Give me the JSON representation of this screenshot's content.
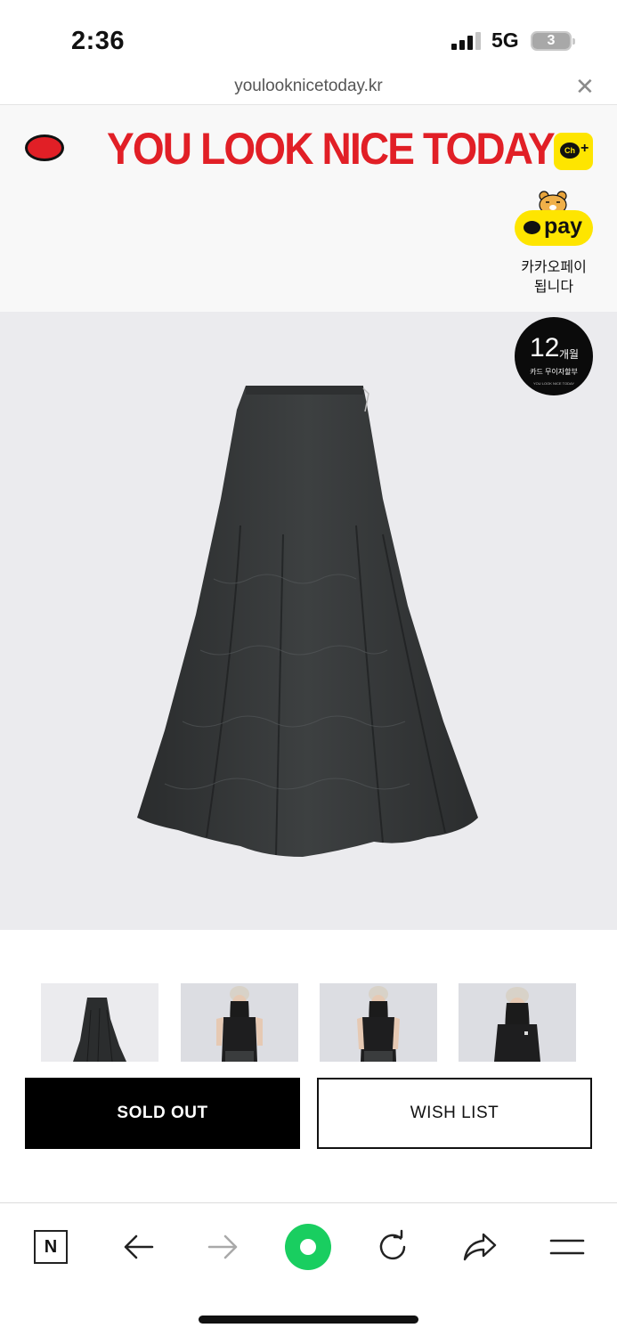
{
  "status_bar": {
    "time": "2:36",
    "network": "5G",
    "battery": "3",
    "colors": {
      "battery_low": "#e5484d"
    }
  },
  "browser": {
    "url": "youlooknicetoday.kr",
    "close_icon": "close-icon"
  },
  "header": {
    "logo_text": "YOU LOOK NICE TODAY",
    "kakao_channel_label": "Ch",
    "kakao_pay": {
      "pill_text": "pay",
      "caption_line1": "카카오페이",
      "caption_line2": "됩니다"
    },
    "colors": {
      "brand_red": "#e11f26",
      "kakao_yellow": "#fee500"
    }
  },
  "product": {
    "image_alt": "black shirred maxi skirt",
    "badge": {
      "number": "12",
      "unit": "개월",
      "subtitle": "카드 무이자할부",
      "fine_print": "YOU LOOK NICE TODAY"
    },
    "thumbnails": [
      {
        "name": "skirt-flat"
      },
      {
        "name": "model-front-1"
      },
      {
        "name": "model-front-2"
      },
      {
        "name": "model-front-3"
      }
    ]
  },
  "actions": {
    "sold_out_label": "SOLD OUT",
    "wish_list_label": "WISH LIST"
  },
  "bottom_nav": {
    "items": [
      {
        "icon": "naver-n-icon",
        "label": "N"
      },
      {
        "icon": "back-arrow-icon"
      },
      {
        "icon": "forward-arrow-icon"
      },
      {
        "icon": "green-dot-icon"
      },
      {
        "icon": "reload-icon"
      },
      {
        "icon": "share-icon"
      },
      {
        "icon": "menu-icon"
      }
    ],
    "colors": {
      "green": "#19ce60"
    }
  }
}
